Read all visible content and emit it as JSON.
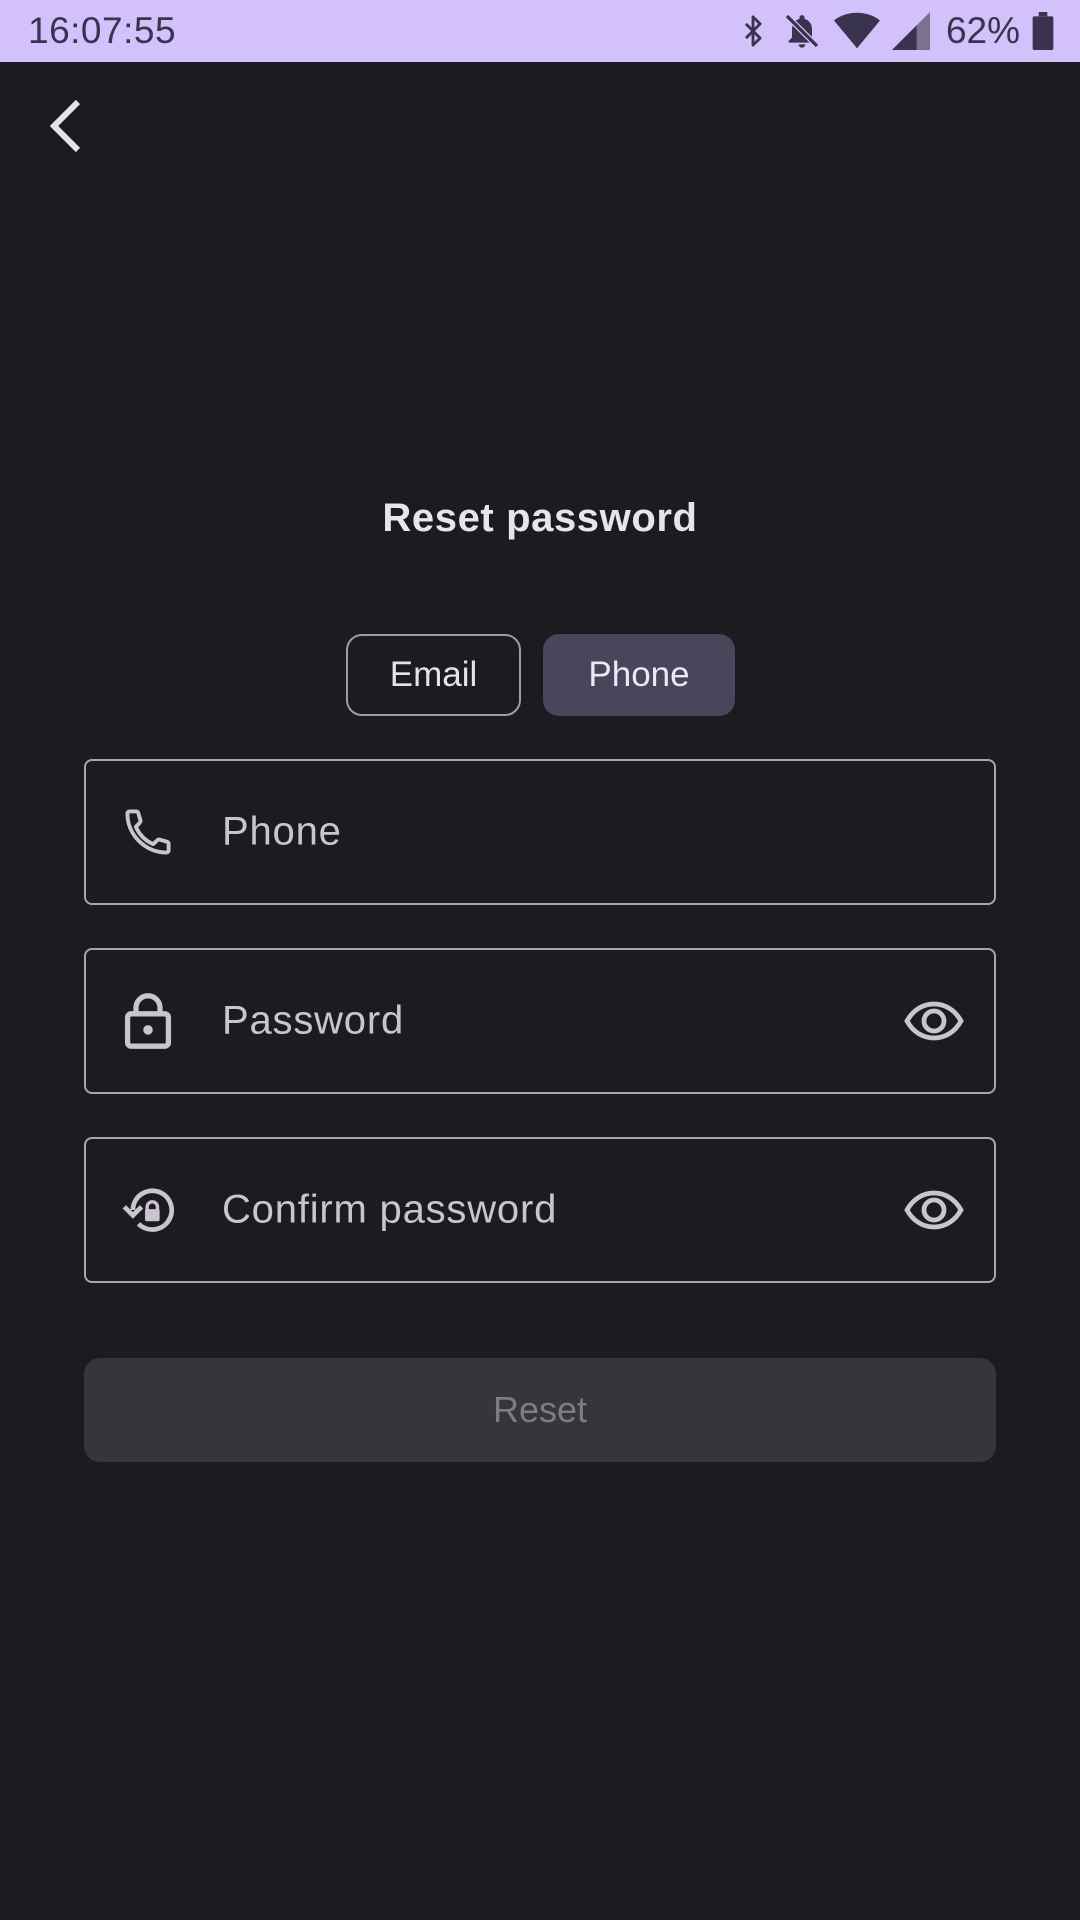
{
  "status_bar": {
    "time": "16:07:55",
    "battery": "62%",
    "icons": [
      "bluetooth-icon",
      "notifications-off-icon",
      "wifi-icon",
      "cellular-signal-icon",
      "battery-icon"
    ]
  },
  "header": {
    "back_icon": "chevron-left-icon"
  },
  "page": {
    "title": "Reset password"
  },
  "tabs": [
    {
      "label": "Email",
      "selected": false
    },
    {
      "label": "Phone",
      "selected": true
    }
  ],
  "form": {
    "phone": {
      "placeholder": "Phone",
      "value": "",
      "icon": "phone-icon"
    },
    "password": {
      "placeholder": "Password",
      "value": "",
      "icon": "lock-icon",
      "toggle_icon": "eye-icon"
    },
    "confirm_password": {
      "placeholder": "Confirm password",
      "value": "",
      "icon": "lock-reset-icon",
      "toggle_icon": "eye-icon"
    },
    "reset_label": "Reset",
    "reset_enabled": false
  },
  "colors": {
    "background": "#1c1b20",
    "status_bar": "#d3c1fb",
    "tab_selected": "#49455a",
    "button_disabled": "#36353a"
  }
}
